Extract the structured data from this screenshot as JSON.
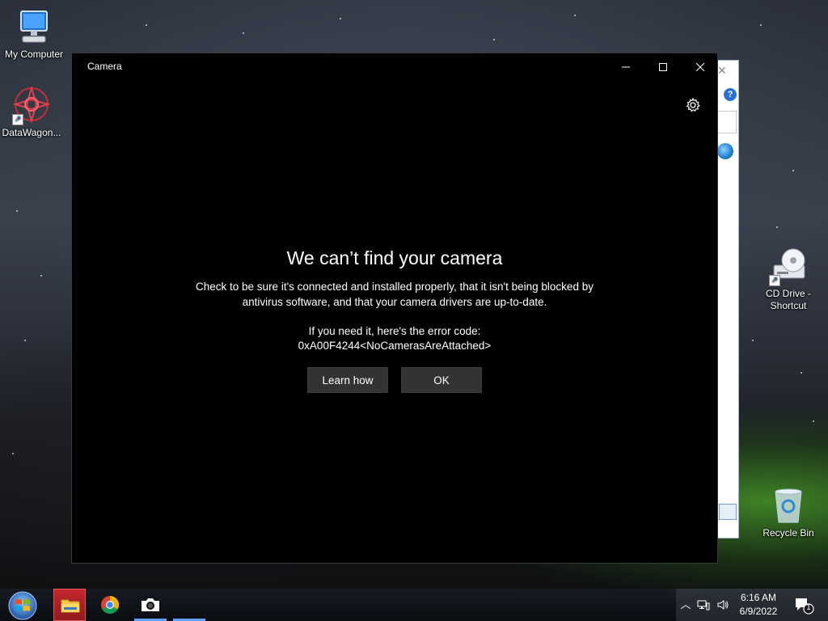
{
  "desktop": {
    "icons": [
      {
        "label": "My Computer"
      },
      {
        "label": "DataWagon..."
      },
      {
        "label": "CD Drive - Shortcut"
      },
      {
        "label": "Recycle Bin"
      }
    ]
  },
  "camera_app": {
    "title": "Camera",
    "error": {
      "heading": "We can’t find your camera",
      "message": "Check to be sure it's connected and installed properly, that it isn't being blocked by antivirus software, and that your camera drivers are up-to-date.",
      "code_caption": "If you need it, here's the error code:",
      "code": "0xA00F4244<NoCamerasAreAttached>"
    },
    "buttons": {
      "learn_how": "Learn how",
      "ok": "OK"
    }
  },
  "taskbar": {
    "clock": {
      "time": "6:16 AM",
      "date": "6/9/2022"
    },
    "notification_count": "1"
  },
  "colors": {
    "window_bg": "#000000",
    "button_bg": "#333333",
    "accent": "#5aa0ff"
  }
}
